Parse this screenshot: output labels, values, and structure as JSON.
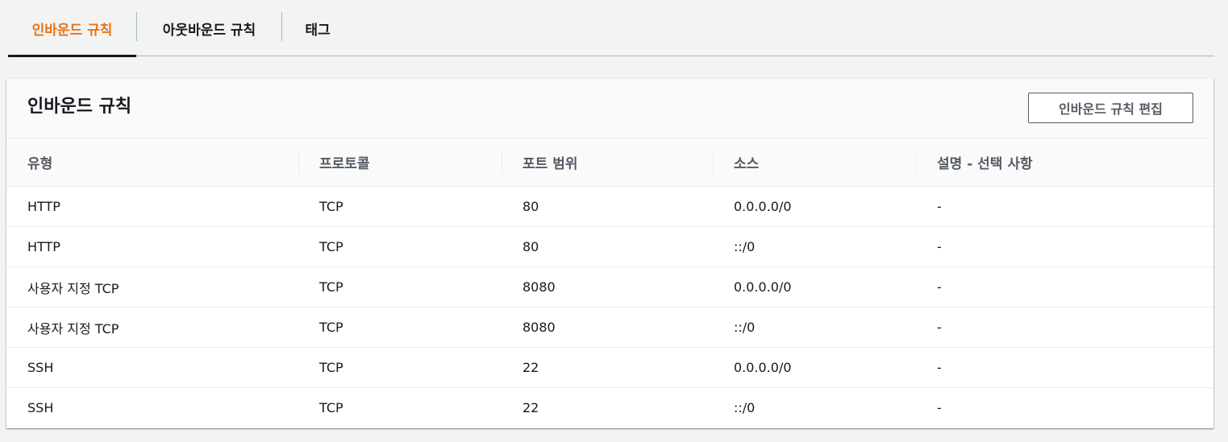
{
  "tabs": [
    {
      "label": "인바운드 규칙",
      "active": true
    },
    {
      "label": "아웃바운드 규칙",
      "active": false
    },
    {
      "label": "태그",
      "active": false
    }
  ],
  "panel": {
    "title": "인바운드 규칙",
    "edit_button_label": "인바운드 규칙 편집"
  },
  "table": {
    "columns": [
      "유형",
      "프로토콜",
      "포트 범위",
      "소스",
      "설명 - 선택 사항"
    ],
    "rows": [
      [
        "HTTP",
        "TCP",
        "80",
        "0.0.0.0/0",
        "-"
      ],
      [
        "HTTP",
        "TCP",
        "80",
        "::/0",
        "-"
      ],
      [
        "사용자 지정 TCP",
        "TCP",
        "8080",
        "0.0.0.0/0",
        "-"
      ],
      [
        "사용자 지정 TCP",
        "TCP",
        "8080",
        "::/0",
        "-"
      ],
      [
        "SSH",
        "TCP",
        "22",
        "0.0.0.0/0",
        "-"
      ],
      [
        "SSH",
        "TCP",
        "22",
        "::/0",
        "-"
      ]
    ]
  },
  "colors": {
    "active_tab": "#ec7211",
    "text": "#16191f",
    "header_text": "#545b64",
    "page_background": "#f2f3f3"
  }
}
